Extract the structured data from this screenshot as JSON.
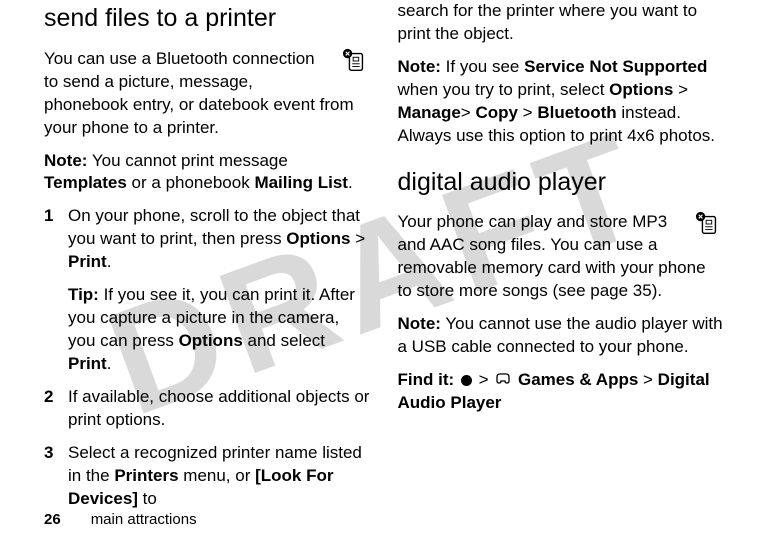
{
  "watermark": "DRAFT",
  "left": {
    "heading": "send files to a printer",
    "intro": "You can use a Bluetooth connection to send a picture, message, phonebook entry, or datebook event from your phone to a printer.",
    "note_prefix": "Note:",
    "note_text_1": " You cannot print message ",
    "note_b1": "Templates",
    "note_text_2": " or a phonebook ",
    "note_b2": "Mailing List",
    "note_text_3": ".",
    "steps": {
      "s1": {
        "num": "1",
        "a1": "On your phone, scroll to the object that you want to print, then press ",
        "b1": "Options",
        "sep": " > ",
        "b2": "Print",
        "a2": ".",
        "tip_prefix": "Tip:",
        "tip_text_1": " If you see it, you can print it. After you capture a picture in the camera, you can press ",
        "tip_b1": "Options",
        "tip_text_2": " and select ",
        "tip_b2": "Print",
        "tip_text_3": "."
      },
      "s2": {
        "num": "2",
        "text": "If available, choose additional objects or print options."
      },
      "s3": {
        "num": "3",
        "a1": "Select a recognized printer name listed in the ",
        "b1": "Printers",
        "a2": " menu, or ",
        "b2": "[Look For Devices]",
        "a3": " to"
      }
    }
  },
  "right": {
    "cont": "search for the printer where you want to print the object.",
    "note_prefix": "Note:",
    "note_text_1": " If you see ",
    "note_b1": "Service Not Supported",
    "note_text_2": " when you try to print, select ",
    "note_b2": "Options",
    "sep": " > ",
    "note_b3": "Manage",
    "sep2": "> ",
    "note_b4": "Copy",
    "note_b5": "Bluetooth",
    "note_text_3": " instead. Always use this option to print 4x6 photos.",
    "heading": "digital audio player",
    "intro": "Your phone can play and store MP3 and AAC song files. You can use a removable memory card with your phone to store more songs (see page 35).",
    "note2_prefix": "Note:",
    "note2_text": " You cannot use the audio player with a USB cable connected to your phone.",
    "find_prefix": "Find it:",
    "find_sep": " > ",
    "find_b1": "Games & Apps",
    "find_b2": "Digital Audio Player"
  },
  "footer": {
    "page": "26",
    "section": "main attractions"
  }
}
